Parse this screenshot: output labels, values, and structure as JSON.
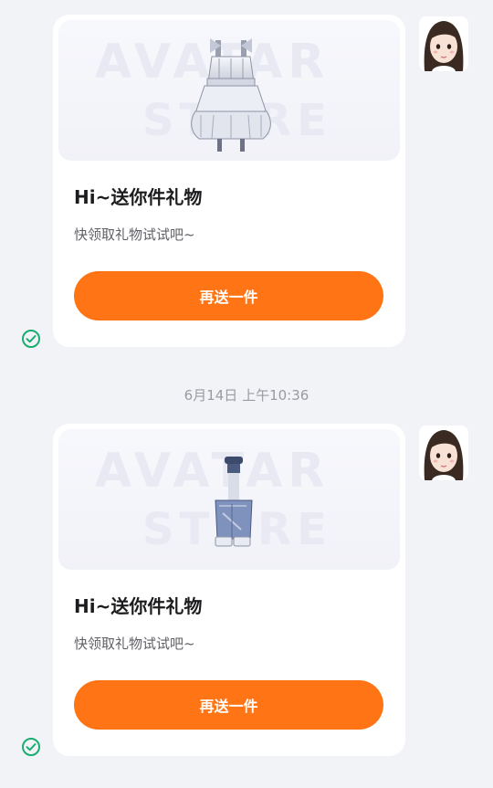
{
  "colors": {
    "background": "#f2f3f7",
    "card": "#ffffff",
    "accent_button": "#ff7414",
    "sent_check": "#1aad72",
    "timestamp_text": "#9a9aa2"
  },
  "timestamp": "6月14日 上午10:36",
  "messages": [
    {
      "gift_image": {
        "description_icon": "dress-icon",
        "watermark_lines": [
          "AVATAR",
          "STORE"
        ]
      },
      "title": "Hi~送你件礼物",
      "subtitle": "快领取礼物试试吧~",
      "button_label": "再送一件",
      "status_icon": "check-circle-icon",
      "avatar_icon": "girl-avatar-icon"
    },
    {
      "gift_image": {
        "description_icon": "jeans-icon",
        "watermark_lines": [
          "AVATAR",
          "STORE"
        ]
      },
      "title": "Hi~送你件礼物",
      "subtitle": "快领取礼物试试吧~",
      "button_label": "再送一件",
      "status_icon": "check-circle-icon",
      "avatar_icon": "girl-avatar-icon"
    }
  ]
}
